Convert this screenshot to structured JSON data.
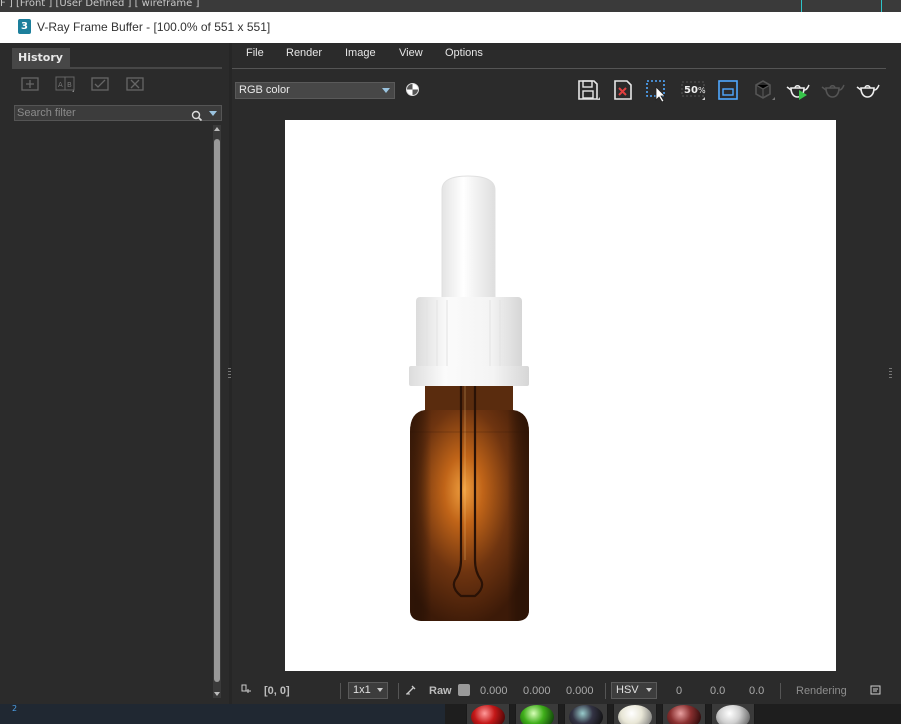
{
  "viewport": {
    "label": "F ] [Front ] [User Defined ] [ wireframe ]"
  },
  "window": {
    "title": "V-Ray Frame Buffer - [100.0% of 551 x 551]"
  },
  "history": {
    "tab_label": "History",
    "search_placeholder": "Search filter",
    "toolbar_icons": [
      "save-to-history-icon",
      "ab-compare-icon",
      "load-from-history-icon",
      "remove-from-history-icon"
    ]
  },
  "menu": {
    "items": [
      "File",
      "Render",
      "Image",
      "View",
      "Options"
    ]
  },
  "toolbar": {
    "channel": "RGB color",
    "zoom_badge": "50",
    "icons": [
      "save-image-icon",
      "clear-image-icon",
      "region-render-icon",
      "zoom-50-icon",
      "frame-icon",
      "lock-3d-icon",
      "render-interactive-teapot-icon",
      "render-teapot-disabled-icon",
      "render-teapot-icon"
    ]
  },
  "status": {
    "coords": "[0, 0]",
    "sample": "1x1",
    "raw_label": "Raw",
    "r": "0.000",
    "g": "0.000",
    "b": "0.000",
    "color_mode": "HSV",
    "h": "0",
    "s": "0.0",
    "v": "0.0",
    "state": "Rendering"
  },
  "material_strip": {
    "marker": "2"
  },
  "colors": {
    "accent": "#2ec3c9",
    "app_icon": "#1c7f9c",
    "bottle_amber": "#7a3a10",
    "cap_white": "#f2f2f2"
  }
}
